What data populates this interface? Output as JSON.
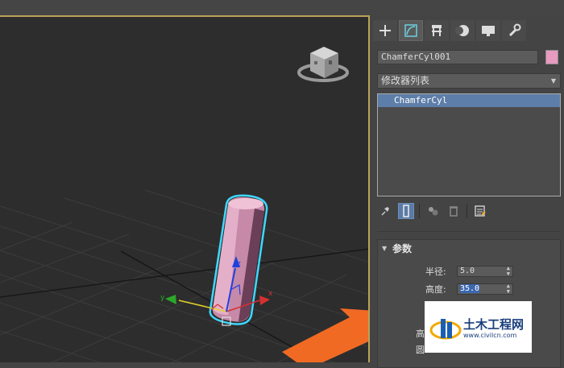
{
  "toolbar_tabs": [
    {
      "name": "create",
      "icon": "plus-icon",
      "active": false
    },
    {
      "name": "modify",
      "icon": "modify-curve-icon",
      "active": true
    },
    {
      "name": "hierarchy",
      "icon": "hierarchy-icon",
      "active": false
    },
    {
      "name": "motion",
      "icon": "motion-sphere-icon",
      "active": false
    },
    {
      "name": "display",
      "icon": "display-monitor-icon",
      "active": false
    },
    {
      "name": "utilities",
      "icon": "wrench-icon",
      "active": false
    }
  ],
  "object": {
    "name": "ChamferCyl001",
    "color": "#e89ac0"
  },
  "modifier_list": {
    "label": "修改器列表"
  },
  "stack": {
    "items": [
      "ChamferCyl"
    ]
  },
  "params": {
    "title": "参数",
    "radius_label": "半径:",
    "radius_value": "5.0",
    "height_label": "高度:",
    "height_value": "35.0",
    "partial_label_1": "高",
    "partial_label_2": "圆"
  },
  "viewport": {
    "axis_x": "x",
    "axis_y": "y",
    "axis_z": "z",
    "gizmo_axes": {
      "x": "#d63030",
      "y": "#2aa82a",
      "z": "#2040e0"
    },
    "selection_outline": "#3ed8ff"
  },
  "watermark": {
    "title": "土木工程网",
    "url": "www.civilcn.com"
  }
}
